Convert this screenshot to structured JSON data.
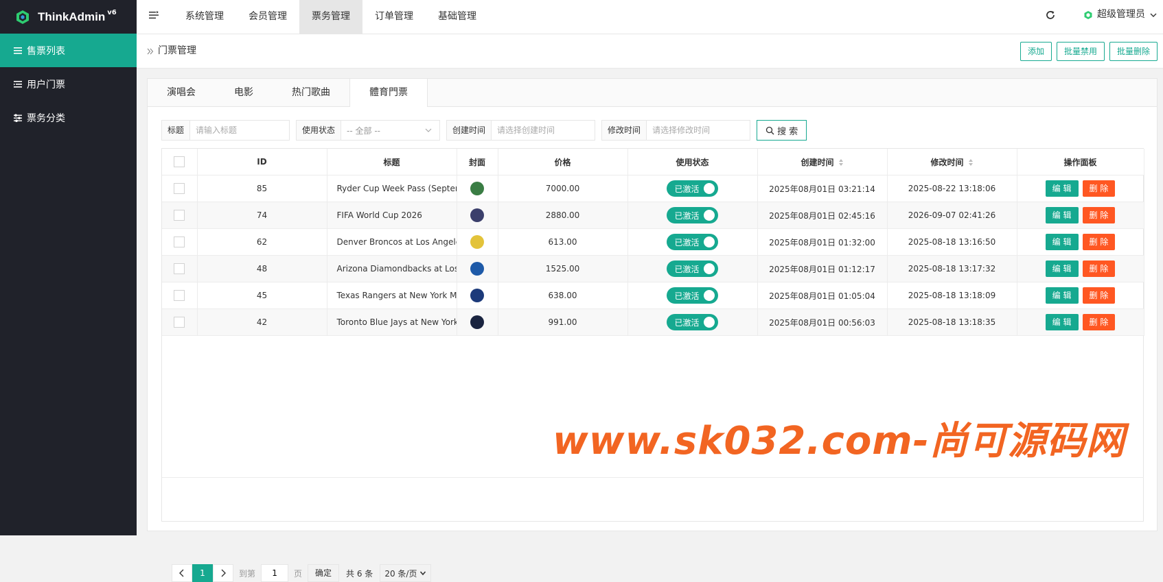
{
  "app": {
    "logo_text": "ThinkAdmin",
    "logo_version": "v6"
  },
  "sidebar": {
    "items": [
      {
        "label": "售票列表",
        "active": true
      },
      {
        "label": "用户门票",
        "active": false
      },
      {
        "label": "票务分类",
        "active": false
      }
    ]
  },
  "topnav": {
    "items": [
      {
        "label": "系统管理"
      },
      {
        "label": "会员管理"
      },
      {
        "label": "票务管理"
      },
      {
        "label": "订单管理"
      },
      {
        "label": "基础管理"
      }
    ],
    "active_index": 2
  },
  "user": {
    "name": "超级管理员"
  },
  "breadcrumb": {
    "title": "门票管理"
  },
  "actions": {
    "add": "添加",
    "batch_disable": "批量禁用",
    "batch_delete": "批量删除"
  },
  "tabs": {
    "items": [
      {
        "label": "演唱会"
      },
      {
        "label": "电影"
      },
      {
        "label": "热门歌曲"
      },
      {
        "label": "體育門票"
      }
    ],
    "active_index": 3
  },
  "filters": {
    "title_label": "标题",
    "title_placeholder": "请输入标题",
    "status_label": "使用状态",
    "status_value": "-- 全部 --",
    "create_label": "创建时间",
    "create_placeholder": "请选择创建时间",
    "modify_label": "修改时间",
    "modify_placeholder": "请选择修改时间",
    "search_label": "搜 索"
  },
  "table": {
    "headers": {
      "id": "ID",
      "title": "标题",
      "cover": "封面",
      "price": "价格",
      "status": "使用状态",
      "created": "创建时间",
      "modified": "修改时间",
      "ops": "操作面板"
    },
    "edit_label": "编 辑",
    "delete_label": "删 除",
    "rows": [
      {
        "id": "85",
        "title": "Ryder Cup Week Pass (Septemb",
        "price": "7000.00",
        "status": "已激活",
        "created": "2025年08月01日 03:21:14",
        "modified": "2025-08-22 13:18:06",
        "cover_color": "#3a7d44"
      },
      {
        "id": "74",
        "title": "FIFA World Cup 2026",
        "price": "2880.00",
        "status": "已激活",
        "created": "2025年08月01日 02:45:16",
        "modified": "2026-09-07 02:41:26",
        "cover_color": "#3b3f6b"
      },
      {
        "id": "62",
        "title": "Denver Broncos at Los Angeles (",
        "price": "613.00",
        "status": "已激活",
        "created": "2025年08月01日 01:32:00",
        "modified": "2025-08-18 13:16:50",
        "cover_color": "#e3c33a"
      },
      {
        "id": "48",
        "title": "Arizona Diamondbacks at Los Ar",
        "price": "1525.00",
        "status": "已激活",
        "created": "2025年08月01日 01:12:17",
        "modified": "2025-08-18 13:17:32",
        "cover_color": "#1e5aa8"
      },
      {
        "id": "45",
        "title": "Texas Rangers at New York Mets",
        "price": "638.00",
        "status": "已激活",
        "created": "2025年08月01日 01:05:04",
        "modified": "2025-08-18 13:18:09",
        "cover_color": "#1c3a7a"
      },
      {
        "id": "42",
        "title": "Toronto Blue Jays at New York Y",
        "price": "991.00",
        "status": "已激活",
        "created": "2025年08月01日 00:56:03",
        "modified": "2025-08-18 13:18:35",
        "cover_color": "#1a2440"
      }
    ]
  },
  "watermark": "www.sk032.com-尚可源码网",
  "pager": {
    "current": "1",
    "goto_label": "到第",
    "page_input": "1",
    "page_unit": "页",
    "confirm": "确定",
    "total": "共 6 条",
    "page_size": "20 条/页"
  },
  "colors": {
    "sidebar_bg": "#20222a",
    "accent": "#16a990",
    "danger": "#ff5722",
    "watermark": "#f26522"
  }
}
